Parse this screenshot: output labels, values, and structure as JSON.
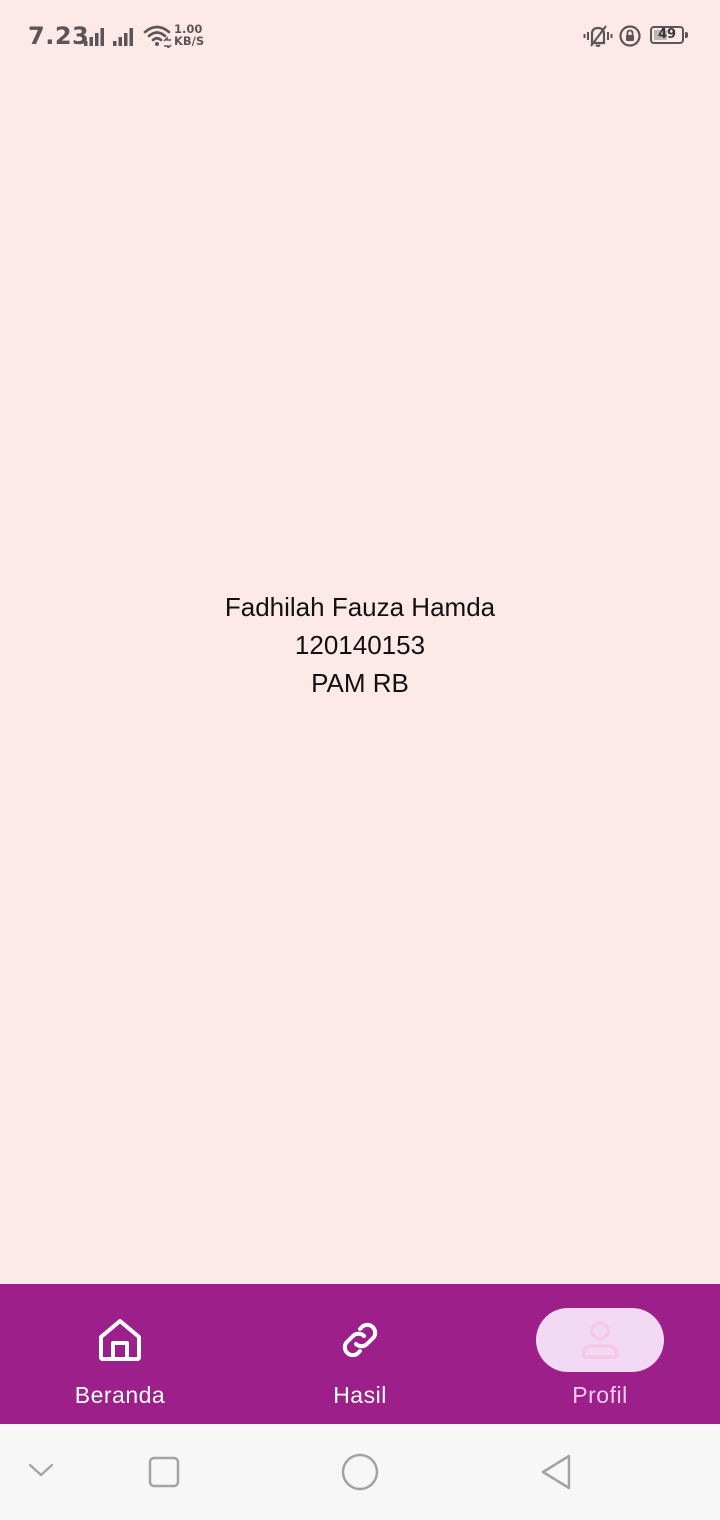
{
  "status_bar": {
    "time": "7.23",
    "net_speed_value": "1.00",
    "net_speed_unit": "KB/S",
    "battery_level": "49",
    "battery_fraction": 0.49
  },
  "profile": {
    "name": "Fadhilah Fauza Hamda",
    "student_id": "120140153",
    "class": "PAM RB"
  },
  "bottom_nav": {
    "items": [
      {
        "label": "Beranda",
        "icon": "home-icon",
        "active": false
      },
      {
        "label": "Hasil",
        "icon": "link-icon",
        "active": false
      },
      {
        "label": "Profil",
        "icon": "person-icon",
        "active": true
      }
    ]
  },
  "colors": {
    "background": "#fde9e8",
    "nav_background": "#9c1f8a",
    "active_pill": "#f1d9f4",
    "active_label": "#f3cdeb"
  },
  "system_nav": {
    "buttons": [
      "chevron-down-icon",
      "recents-square-icon",
      "home-circle-icon",
      "back-triangle-icon"
    ]
  }
}
